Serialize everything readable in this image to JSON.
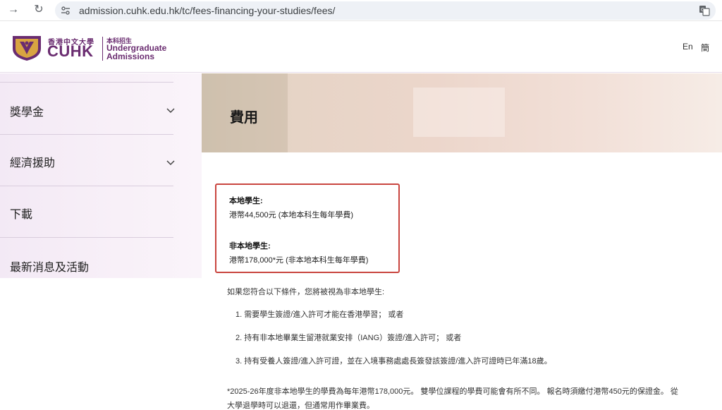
{
  "browser": {
    "url": "admission.cuhk.edu.hk/tc/fees-financing-your-studies/fees/"
  },
  "header": {
    "logo_zh": "香港中文大學",
    "logo_cuhk": "CUHK",
    "sub_zh": "本科招生",
    "sub_en_line1": "Undergraduate",
    "sub_en_line2": "Admissions",
    "lang_en": "En",
    "lang_sc": "簡"
  },
  "sidebar": {
    "items": [
      {
        "label": "獎學金",
        "expandable": true
      },
      {
        "label": "經濟援助",
        "expandable": true
      },
      {
        "label": "下載",
        "expandable": false
      },
      {
        "label": "最新消息及活動",
        "expandable": false
      }
    ]
  },
  "main": {
    "title": "費用",
    "local_heading": "本地學生:",
    "local_fee": "港幣44,500元 (本地本科生每年學費)",
    "nonlocal_heading": "非本地學生:",
    "nonlocal_fee": "港幣178,000*元 (非本地本科生每年學費)",
    "intro": "如果您符合以下條件，您將被視為非本地學生:",
    "conditions": [
      "1.  需要學生簽證/進入許可才能在香港學習； 或者",
      "2. 持有非本地畢業生留港就業安排（IANG）簽證/進入許可； 或者",
      "3. 持有受養人簽證/進入許可證，並在入境事務處處長簽發該簽證/進入許可證時已年滿18歲。"
    ],
    "note_line1": "*2025-26年度非本地學生的學費為每年港幣178,000元。 雙學位課程的學費可能會有所不同。 報名時須繳付港幣450元的保證金。 從",
    "note_line2": "大學退學時可以退還，但通常用作畢業費。"
  },
  "colors": {
    "brand_purple": "#6a2c70",
    "highlight_red": "#c9453f",
    "crest_gold": "#d9a441"
  }
}
